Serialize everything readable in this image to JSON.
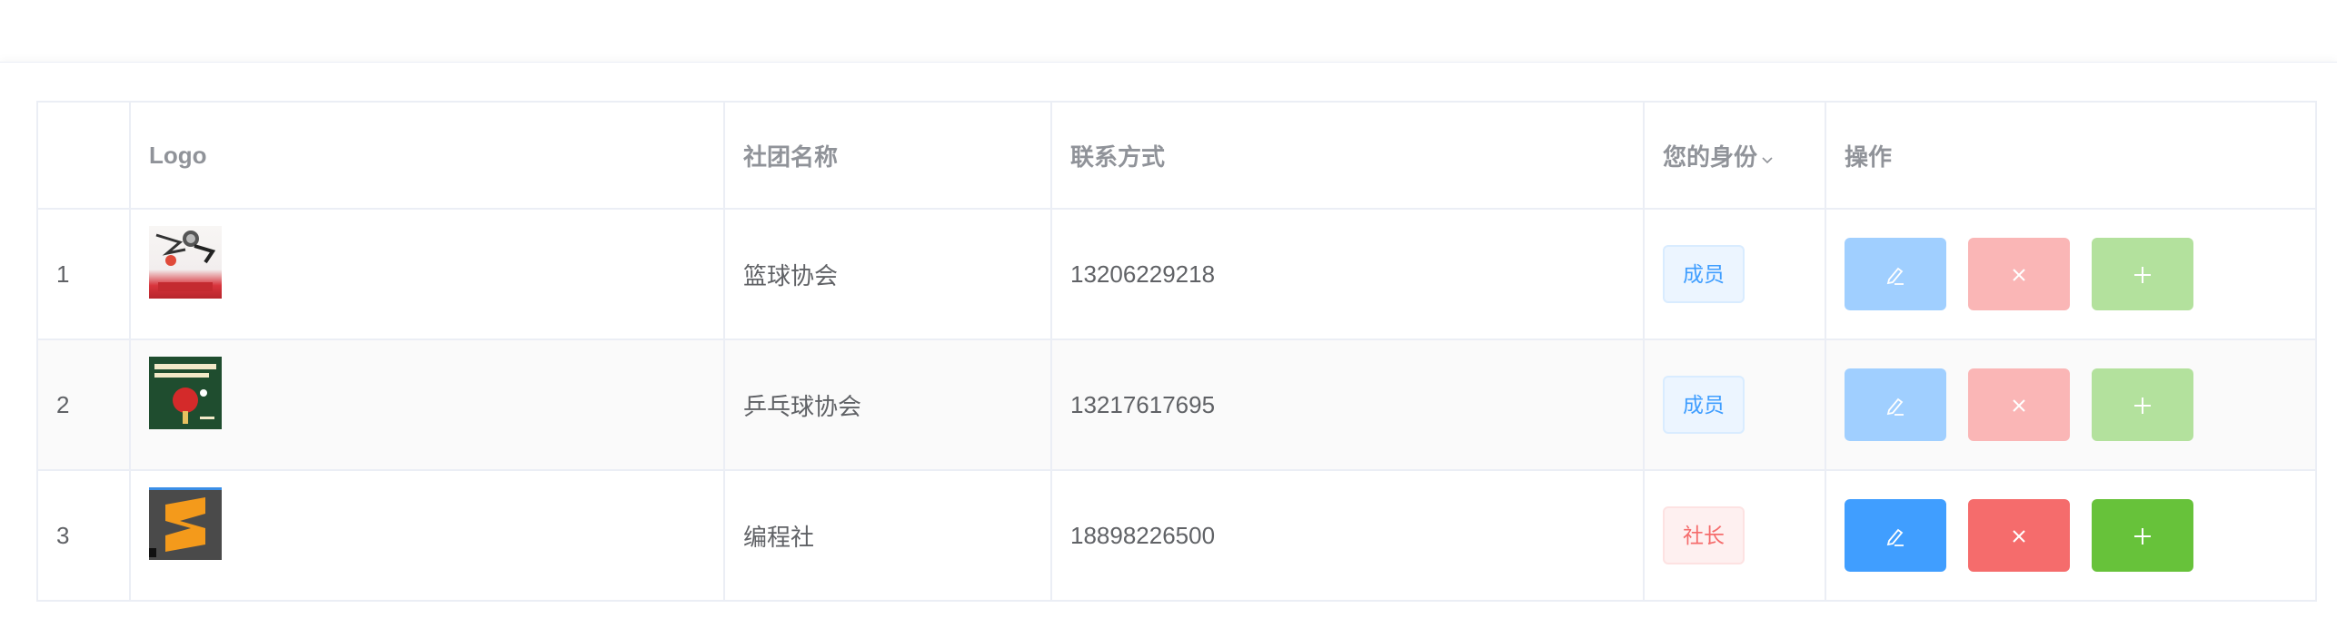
{
  "table": {
    "columns": [
      {
        "key": "index",
        "label": ""
      },
      {
        "key": "logo",
        "label": "Logo"
      },
      {
        "key": "name",
        "label": "社团名称"
      },
      {
        "key": "contact",
        "label": "联系方式"
      },
      {
        "key": "role",
        "label": "您的身份"
      },
      {
        "key": "actions",
        "label": "操作"
      }
    ],
    "sort_icon": "chevron-down-icon",
    "rows": [
      {
        "index": "1",
        "logo": "club-logo-image",
        "name": "篮球协会",
        "contact": "13206229218",
        "role": "成员",
        "role_type": "member",
        "actions_disabled": true
      },
      {
        "index": "2",
        "logo": "club-logo-image",
        "name": "乒乓球协会",
        "contact": "13217617695",
        "role": "成员",
        "role_type": "member",
        "actions_disabled": true
      },
      {
        "index": "3",
        "logo": "club-logo-image",
        "name": "编程社",
        "contact": "18898226500",
        "role": "社长",
        "role_type": "leader",
        "actions_disabled": false
      }
    ],
    "action_icons": {
      "edit": "edit-pen-icon",
      "delete": "close-icon",
      "add": "plus-icon"
    }
  },
  "colors": {
    "primary": "#409eff",
    "danger": "#f56c6c",
    "success": "#67c23a",
    "header_text": "#909399",
    "body_text": "#606266",
    "border": "#ebeef5",
    "stripe": "#fafafa"
  }
}
